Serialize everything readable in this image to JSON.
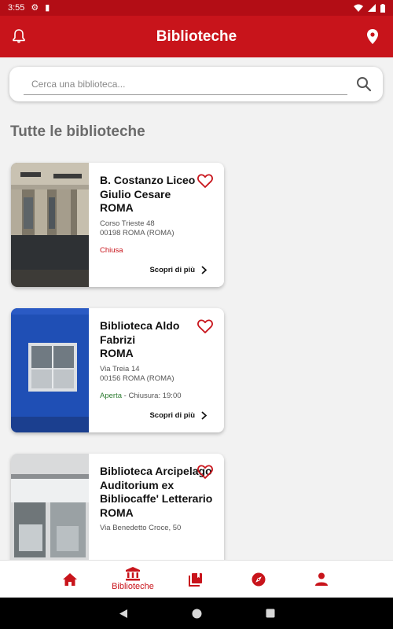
{
  "status_bar": {
    "time": "3:55"
  },
  "app_bar": {
    "title": "Biblioteche"
  },
  "search": {
    "placeholder": "Cerca una biblioteca..."
  },
  "section_title": "Tutte le biblioteche",
  "libraries": [
    {
      "name": "B. Costanzo Liceo Giulio Cesare\n ROMA",
      "street": "Corso Trieste 48",
      "city": "00198 ROMA (ROMA)",
      "status": "Chiusa",
      "hours": "",
      "more_label": "Scopri di più"
    },
    {
      "name": "Biblioteca Aldo Fabrizi\n ROMA",
      "street": "Via Treia 14",
      "city": "00156 ROMA (ROMA)",
      "status": "Aperta",
      "hours": "- Chiusura: 19:00",
      "more_label": "Scopri di più"
    },
    {
      "name": "Biblioteca Arcipelago Auditorium ex Bibliocaffe' Letterario\n ROMA",
      "street": "Via Benedetto Croce, 50",
      "city": "",
      "status": "",
      "hours": "",
      "more_label": ""
    }
  ],
  "bottom_nav": {
    "active_label": "Biblioteche"
  },
  "colors": {
    "primary": "#c8141b",
    "status_bar": "#b30d15",
    "open": "#2e7d32"
  }
}
